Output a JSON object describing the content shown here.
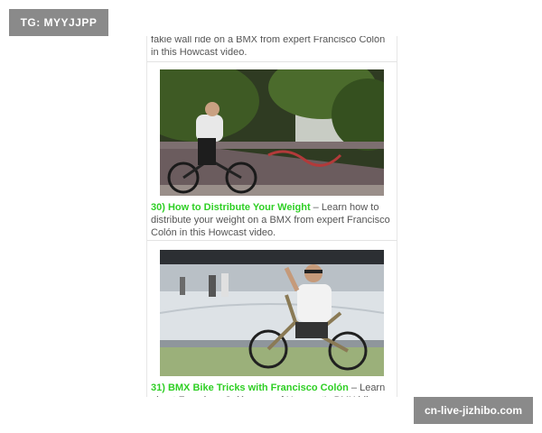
{
  "watermarks": {
    "top_left": "TG: MYYJJPP",
    "bottom_right": "cn-live-jizhibo.com"
  },
  "feed": {
    "items": [
      {
        "description_tail": "fakie wall ride on a BMX from expert Francisco Colón in this Howcast video."
      },
      {
        "title": "30) How to Distribute Your Weight",
        "separator": " – ",
        "description": "Learn how to distribute your weight on a BMX from expert Francisco Colón in this Howcast video."
      },
      {
        "title": "31) BMX Bike Tricks with Francisco Colón",
        "separator": " – ",
        "description": "Learn about Francisco Colón, one of Howcast's BMX bike experts."
      }
    ]
  },
  "colors": {
    "title_green": "#2fcf25",
    "watermark_gray": "#8a8a8a",
    "text_gray": "#555555"
  }
}
